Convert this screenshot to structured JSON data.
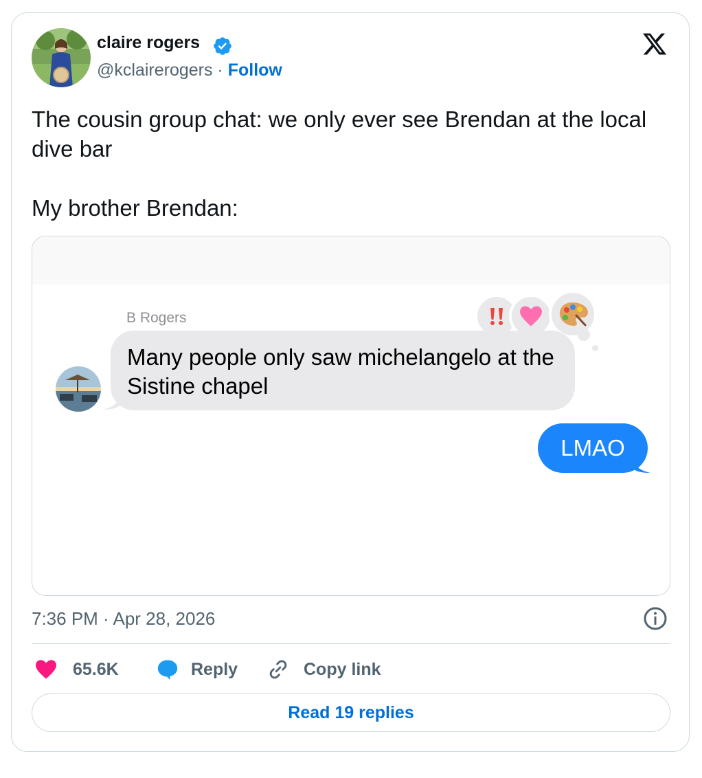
{
  "author": {
    "name": "claire rogers",
    "handle": "@kclairerogers",
    "separator": " · ",
    "follow_label": "Follow"
  },
  "tweet": {
    "line1": "The cousin group chat: we only ever see Brendan at the local dive bar",
    "line2": "My brother Brendan:"
  },
  "chat": {
    "sender": "B Rogers",
    "incoming_message": "Many people only saw michelangelo at the Sistine chapel",
    "outgoing_message": "LMAO",
    "reactions": [
      "double-exclamation-icon",
      "heart-icon",
      "palette-icon"
    ]
  },
  "meta": {
    "timestamp": "7:36 PM · Apr 28, 2026"
  },
  "actions": {
    "likes": "65.6K",
    "reply_label": "Reply",
    "copy_label": "Copy link",
    "read_replies_label": "Read 19 replies"
  },
  "colors": {
    "accent": "#006fd6",
    "like": "#f91880",
    "reply": "#1d9bf0",
    "imessage_blue": "#1b86fb",
    "imessage_gray": "#e9e9eb",
    "reaction_heart": "#ff6fb0"
  }
}
